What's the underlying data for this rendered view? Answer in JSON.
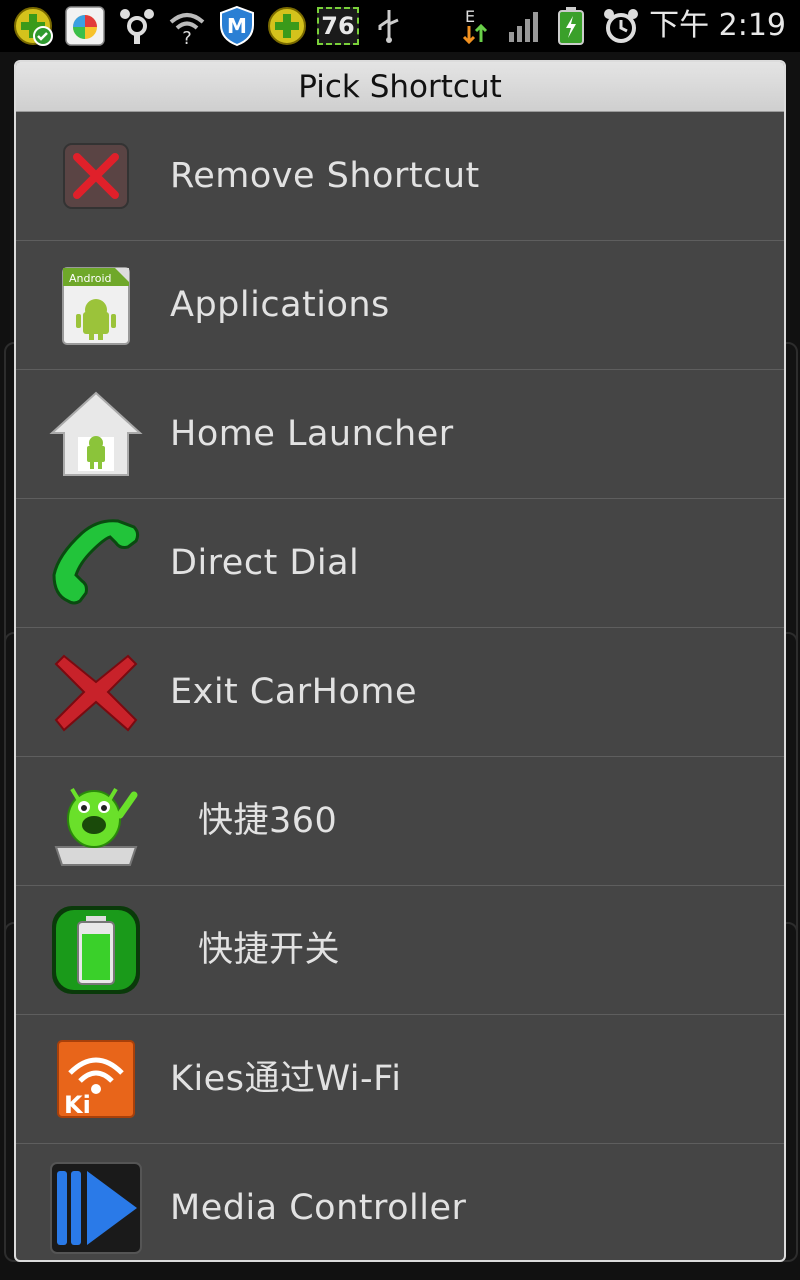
{
  "statusbar": {
    "battery_badge": "76",
    "time": "下午 2:19",
    "network_type": "E"
  },
  "dialog": {
    "title": "Pick Shortcut",
    "items": [
      {
        "label": "Remove Shortcut",
        "icon": "remove-x-icon"
      },
      {
        "label": "Applications",
        "icon": "android-apps-icon"
      },
      {
        "label": "Home Launcher",
        "icon": "home-launcher-icon"
      },
      {
        "label": "Direct Dial",
        "icon": "phone-handset-icon"
      },
      {
        "label": "Exit CarHome",
        "icon": "exit-x-icon"
      },
      {
        "label": "快捷360",
        "icon": "green-monster-icon"
      },
      {
        "label": "快捷开关",
        "icon": "battery-toggle-icon"
      },
      {
        "label": "Kies通过Wi-Fi",
        "icon": "kies-wifi-icon"
      },
      {
        "label": "Media Controller",
        "icon": "media-play-icon"
      }
    ]
  },
  "colors": {
    "dialog_bg": "#454545",
    "title_bg": "#d8d8d8",
    "text": "#e2e2e2",
    "divider": "#5e5e5e"
  }
}
